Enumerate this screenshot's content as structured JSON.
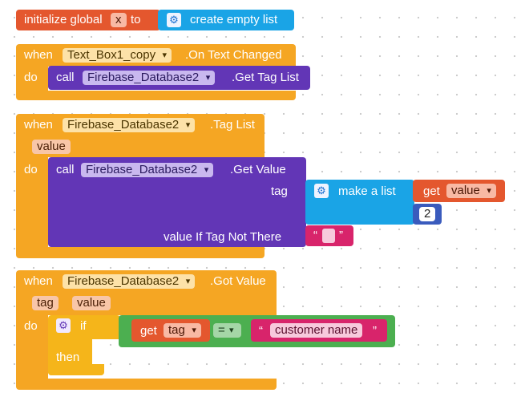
{
  "init_block": {
    "initialize_global": "initialize global",
    "var_name": "x",
    "to": "to",
    "create_empty_list": "create empty list"
  },
  "event1": {
    "when": "when",
    "component": "Text_Box1_copy",
    "event": ".On Text Changed",
    "do": "do",
    "call": "call",
    "target": "Firebase_Database2",
    "method": ".Get Tag List"
  },
  "event2": {
    "when": "when",
    "component": "Firebase_Database2",
    "event": ".Tag List",
    "param": "value",
    "do": "do",
    "call": "call",
    "target": "Firebase_Database2",
    "method": ".Get Value",
    "tag_label": "tag",
    "make_a_list": "make a list",
    "get": "get",
    "get_var": "value",
    "number": "2",
    "default_label": "value If Tag Not There",
    "quote_open": "“",
    "quote_close": "”"
  },
  "event3": {
    "when": "when",
    "component": "Firebase_Database2",
    "event": ".Got Value",
    "param1": "tag",
    "param2": "value",
    "do": "do",
    "if": "if",
    "then": "then",
    "get": "get",
    "get_var": "tag",
    "operator": "=",
    "quote_open": "“",
    "string_value": "customer name",
    "quote_close": "”"
  }
}
